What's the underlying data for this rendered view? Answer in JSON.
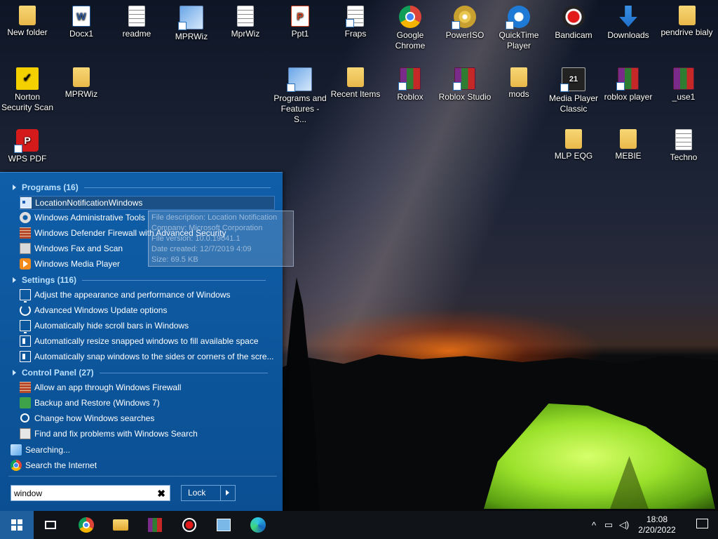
{
  "desktop_icons": [
    {
      "label": "New folder",
      "glyph": "folder-icon"
    },
    {
      "label": "Docx1",
      "glyph": "word-doc-icon"
    },
    {
      "label": "readme",
      "glyph": "text-file-icon"
    },
    {
      "label": "MPRWiz",
      "glyph": "wizard-app-icon"
    },
    {
      "label": "MprWiz",
      "glyph": "text-file-icon"
    },
    {
      "label": "Ppt1",
      "glyph": "powerpoint-doc-icon"
    },
    {
      "label": "Fraps",
      "glyph": "text-file-icon"
    },
    {
      "label": "Google Chrome",
      "glyph": "chrome-icon"
    },
    {
      "label": "PowerISO",
      "glyph": "disc-icon"
    },
    {
      "label": "QuickTime Player",
      "glyph": "quicktime-icon"
    },
    {
      "label": "Bandicam",
      "glyph": "record-icon"
    },
    {
      "label": "Downloads",
      "glyph": "download-arrow-icon"
    },
    {
      "label": "pendrive bialy",
      "glyph": "folder-icon"
    },
    {
      "label": "Norton Security Scan",
      "glyph": "norton-icon"
    },
    {
      "label": "MPRWiz",
      "glyph": "folder-icon"
    },
    {
      "label": "Programs and Features - S...",
      "glyph": "programs-icon"
    },
    {
      "label": "Recent Items",
      "glyph": "folder-icon"
    },
    {
      "label": "Roblox",
      "glyph": "archive-icon"
    },
    {
      "label": "Roblox Studio",
      "glyph": "archive-icon"
    },
    {
      "label": "mods",
      "glyph": "folder-icon"
    },
    {
      "label": "Media Player Classic",
      "glyph": "media-player-icon"
    },
    {
      "label": "roblox player",
      "glyph": "archive-icon"
    },
    {
      "label": "_use1",
      "glyph": "archive-icon"
    },
    {
      "label": "WPS PDF",
      "glyph": "pdf-icon"
    },
    {
      "label": "MLP EQG",
      "glyph": "folder-icon"
    },
    {
      "label": "MEBIE",
      "glyph": "folder-icon"
    },
    {
      "label": "Techno",
      "glyph": "text-file-icon"
    }
  ],
  "start_menu": {
    "programs_header": "Programs (16)",
    "programs": [
      {
        "label": "LocationNotificationWindows",
        "icon": "window-icon"
      },
      {
        "label": "Windows Administrative Tools",
        "icon": "gear-icon"
      },
      {
        "label": "Windows Defender Firewall with Advanced Security",
        "icon": "firewall-icon"
      },
      {
        "label": "Windows Fax and Scan",
        "icon": "fax-icon"
      },
      {
        "label": "Windows Media Player",
        "icon": "media-player-icon"
      }
    ],
    "settings_header": "Settings (116)",
    "settings": [
      {
        "label": "Adjust the appearance and performance of Windows",
        "icon": "monitor-icon"
      },
      {
        "label": "Advanced Windows Update options",
        "icon": "sync-icon"
      },
      {
        "label": "Automatically hide scroll bars in Windows",
        "icon": "monitor-icon"
      },
      {
        "label": "Automatically resize snapped windows to fill available space",
        "icon": "snap-icon"
      },
      {
        "label": "Automatically snap windows to the sides or corners of the scre...",
        "icon": "snap-icon"
      }
    ],
    "control_panel_header": "Control Panel (27)",
    "control_panel": [
      {
        "label": "Allow an app through Windows Firewall",
        "icon": "firewall-icon"
      },
      {
        "label": "Backup and Restore (Windows 7)",
        "icon": "backup-icon"
      },
      {
        "label": "Change how Windows searches",
        "icon": "search-icon"
      },
      {
        "label": "Find and fix problems with Windows Search",
        "icon": "troubleshoot-icon"
      }
    ],
    "searching": "Searching...",
    "search_internet": "Search the Internet",
    "search_value": "window",
    "lock_label": "Lock"
  },
  "tooltip": {
    "lines": [
      "File description: Location Notification",
      "Company: Microsoft Corporation",
      "File version: 10.0.19041.1",
      "Date created: 12/7/2019 4:09",
      "Size: 69.5 KB"
    ]
  },
  "taskbar": {
    "time": "18:08",
    "date": "2/20/2022"
  }
}
